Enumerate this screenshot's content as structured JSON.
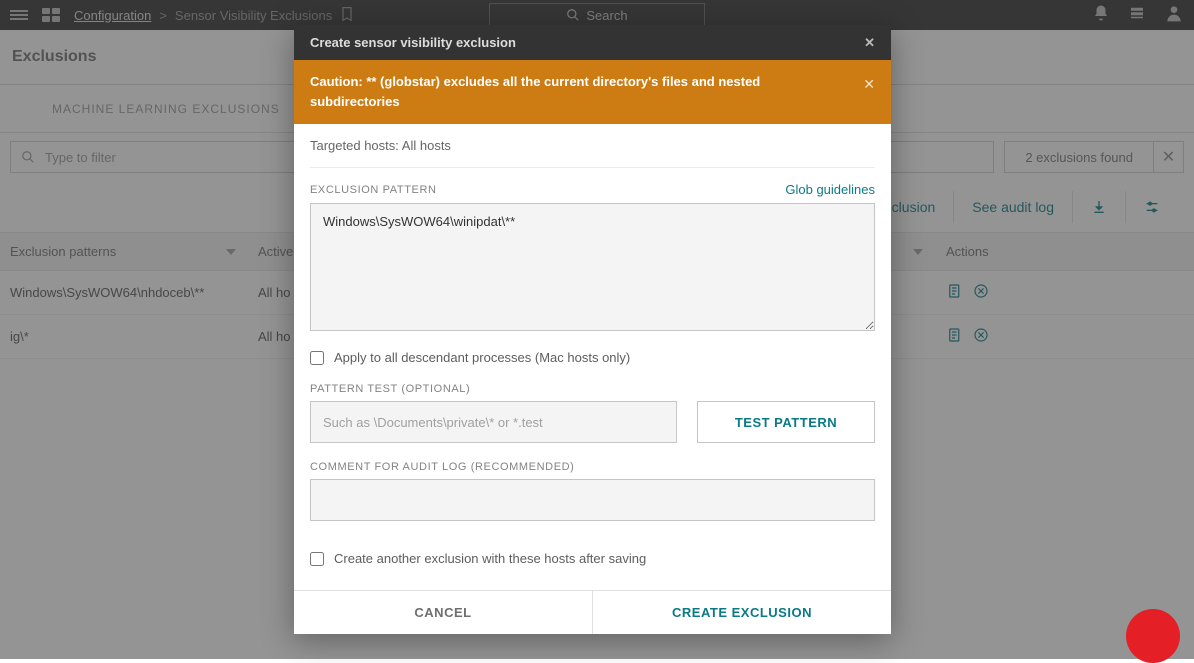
{
  "topbar": {
    "breadcrumb1": "Configuration",
    "breadcrumb_sep": ">",
    "breadcrumb2": "Sensor Visibility Exclusions",
    "search": "Search"
  },
  "page": {
    "title": "Exclusions"
  },
  "tabs": {
    "tab0": "MACHINE LEARNING EXCLUSIONS"
  },
  "filter": {
    "placeholder": "Type to filter",
    "found": "2 exclusions found"
  },
  "actions": {
    "create": "Create exclusion",
    "audit": "See audit log"
  },
  "table": {
    "head": {
      "pattern": "Exclusion patterns",
      "active": "Active",
      "actions_col": "Actions"
    },
    "rows": [
      {
        "pattern": "Windows\\SysWOW64\\nhdoceb\\**",
        "active": "All ho"
      },
      {
        "pattern": "ig\\*",
        "active": "All ho"
      }
    ]
  },
  "modal": {
    "title": "Create sensor visibility exclusion",
    "caution_bold": "Caution: ** (globstar) excludes all the current directory's files and nested subdirectories",
    "hosts_label": "Targeted hosts:",
    "hosts_value": "All hosts",
    "pattern_label": "EXCLUSION PATTERN",
    "glob_link": "Glob guidelines",
    "pattern_value": "Windows\\SysWOW64\\winipdat\\**",
    "apply_check": "Apply to all descendant processes (Mac hosts only)",
    "test_label": "PATTERN TEST (OPTIONAL)",
    "test_placeholder": "Such as \\Documents\\private\\* or *.test",
    "test_button": "TEST PATTERN",
    "comment_label": "COMMENT FOR AUDIT LOG (RECOMMENDED)",
    "create_another": "Create another exclusion with these hosts after saving",
    "cancel": "CANCEL",
    "create": "CREATE EXCLUSION"
  }
}
